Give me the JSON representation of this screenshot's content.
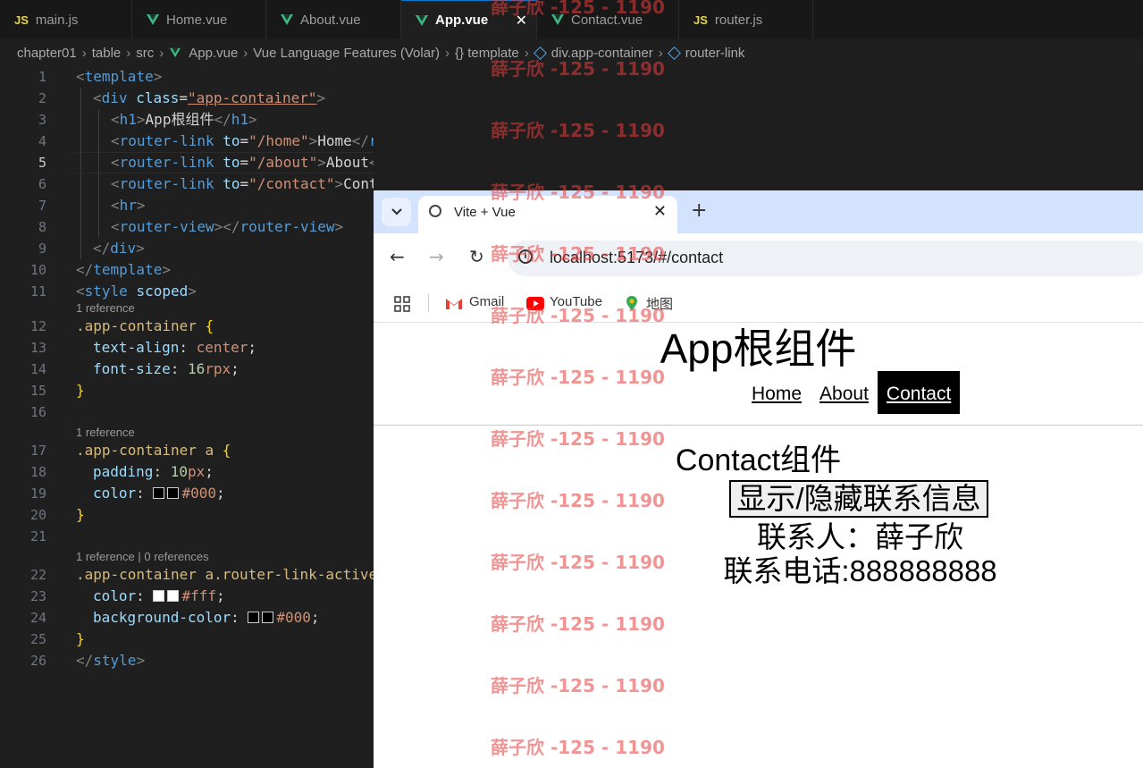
{
  "editor_tabs": [
    {
      "label": "main.js",
      "type": "js"
    },
    {
      "label": "Home.vue",
      "type": "vue"
    },
    {
      "label": "About.vue",
      "type": "vue"
    },
    {
      "label": "App.vue",
      "type": "vue",
      "active": true
    },
    {
      "label": "Contact.vue",
      "type": "vue"
    },
    {
      "label": "router.js",
      "type": "js"
    }
  ],
  "breadcrumb": [
    "chapter01",
    "table",
    "src",
    "App.vue",
    "Vue Language Features (Volar)",
    "{} template",
    "div.app-container",
    "router-link"
  ],
  "code_lens": {
    "l12": "1 reference",
    "l17": "1 reference",
    "l22": "1 reference | 0 references"
  },
  "code": {
    "ln": [
      "1",
      "2",
      "3",
      "4",
      "5",
      "6",
      "7",
      "8",
      "9",
      "10",
      "11",
      "12",
      "13",
      "14",
      "15",
      "16",
      "17",
      "18",
      "19",
      "20",
      "21",
      "22",
      "23",
      "24",
      "25",
      "26"
    ],
    "template": "template",
    "div": "div",
    "class_attr": "class",
    "app_container_str": "\"app-container\"",
    "h1": "h1",
    "h1_text": "App根组件",
    "router_link": "router-link",
    "to": "to",
    "home_str": "\"/home\"",
    "home_text": "Home",
    "about_str": "\"/about\"",
    "about_text": "About",
    "contact_str": "\"/contact\"",
    "contact_text": "Contact",
    "hr": "hr",
    "router_view": "router-view",
    "style": "style",
    "scoped": "scoped",
    "sel1": ".app-container",
    "sel2": ".app-container a",
    "sel3": ".app-container a.router-link-active",
    "text_align": "text-align",
    "center": "center",
    "font_size": "font-size",
    "font_size_num": "16",
    "font_size_unit": "rpx",
    "padding": "padding",
    "padding_num": "10",
    "padding_unit": "px",
    "color": "color",
    "color_black": "#000",
    "color_white": "#fff",
    "background_color": "background-color",
    "bg_black": "#000"
  },
  "browser": {
    "tab_title": "Vite + Vue",
    "url": "localhost:5173/#/contact",
    "bookmarks": [
      "Gmail",
      "YouTube",
      "地图"
    ]
  },
  "page": {
    "title": "App根组件",
    "nav": [
      "Home",
      "About",
      "Contact"
    ],
    "active_nav": "Contact",
    "contact_title": "Contact组件",
    "toggle_button": "显示/隐藏联系信息",
    "contact_person": "联系人：薛子欣",
    "contact_phone": "联系电话:888888888"
  },
  "watermark": "薛子欣 -125 - 1190",
  "colors": {
    "vue_green": "#41b883",
    "js_yellow": "#e8d44d",
    "accent_blue": "#0078d4"
  }
}
